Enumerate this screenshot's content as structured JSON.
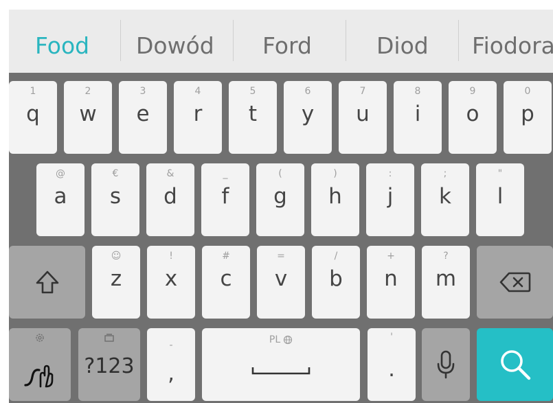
{
  "suggestions": {
    "primary": "Food",
    "items": [
      "Dowód",
      "Ford",
      "Diod",
      "Fiodora"
    ]
  },
  "colors": {
    "accent": "#25bfc6",
    "keyboard_bg": "#707070",
    "key_bg": "#f3f3f3",
    "function_key_bg": "#a5a5a5",
    "suggestion_bar_bg": "#ebebeb"
  },
  "rows": {
    "row1": [
      {
        "letter": "q",
        "hint": "1"
      },
      {
        "letter": "w",
        "hint": "2"
      },
      {
        "letter": "e",
        "hint": "3"
      },
      {
        "letter": "r",
        "hint": "4"
      },
      {
        "letter": "t",
        "hint": "5"
      },
      {
        "letter": "y",
        "hint": "6"
      },
      {
        "letter": "u",
        "hint": "7"
      },
      {
        "letter": "i",
        "hint": "8"
      },
      {
        "letter": "o",
        "hint": "9"
      },
      {
        "letter": "p",
        "hint": "0"
      }
    ],
    "row2": [
      {
        "letter": "a",
        "hint": "@"
      },
      {
        "letter": "s",
        "hint": "€"
      },
      {
        "letter": "d",
        "hint": "&"
      },
      {
        "letter": "f",
        "hint": "_"
      },
      {
        "letter": "g",
        "hint": "("
      },
      {
        "letter": "h",
        "hint": ")"
      },
      {
        "letter": "j",
        "hint": ":"
      },
      {
        "letter": "k",
        "hint": ";"
      },
      {
        "letter": "l",
        "hint": "\""
      }
    ],
    "row3": [
      {
        "letter": "z",
        "hint": "☺"
      },
      {
        "letter": "x",
        "hint": "!"
      },
      {
        "letter": "c",
        "hint": "#"
      },
      {
        "letter": "v",
        "hint": "="
      },
      {
        "letter": "b",
        "hint": "/"
      },
      {
        "letter": "n",
        "hint": "+"
      },
      {
        "letter": "m",
        "hint": "?"
      }
    ]
  },
  "bottom": {
    "numbers_label": "?123",
    "comma": ",",
    "comma_hint": "-",
    "space_hint": "PL",
    "period": ".",
    "period_hint": "'"
  },
  "icons": {
    "shift": "shift-icon",
    "backspace": "backspace-icon",
    "gesture": "swipe-gesture-icon",
    "settings": "gear-icon",
    "clipboard": "clipboard-icon",
    "globe": "globe-icon",
    "mic": "microphone-icon",
    "search": "search-icon"
  }
}
